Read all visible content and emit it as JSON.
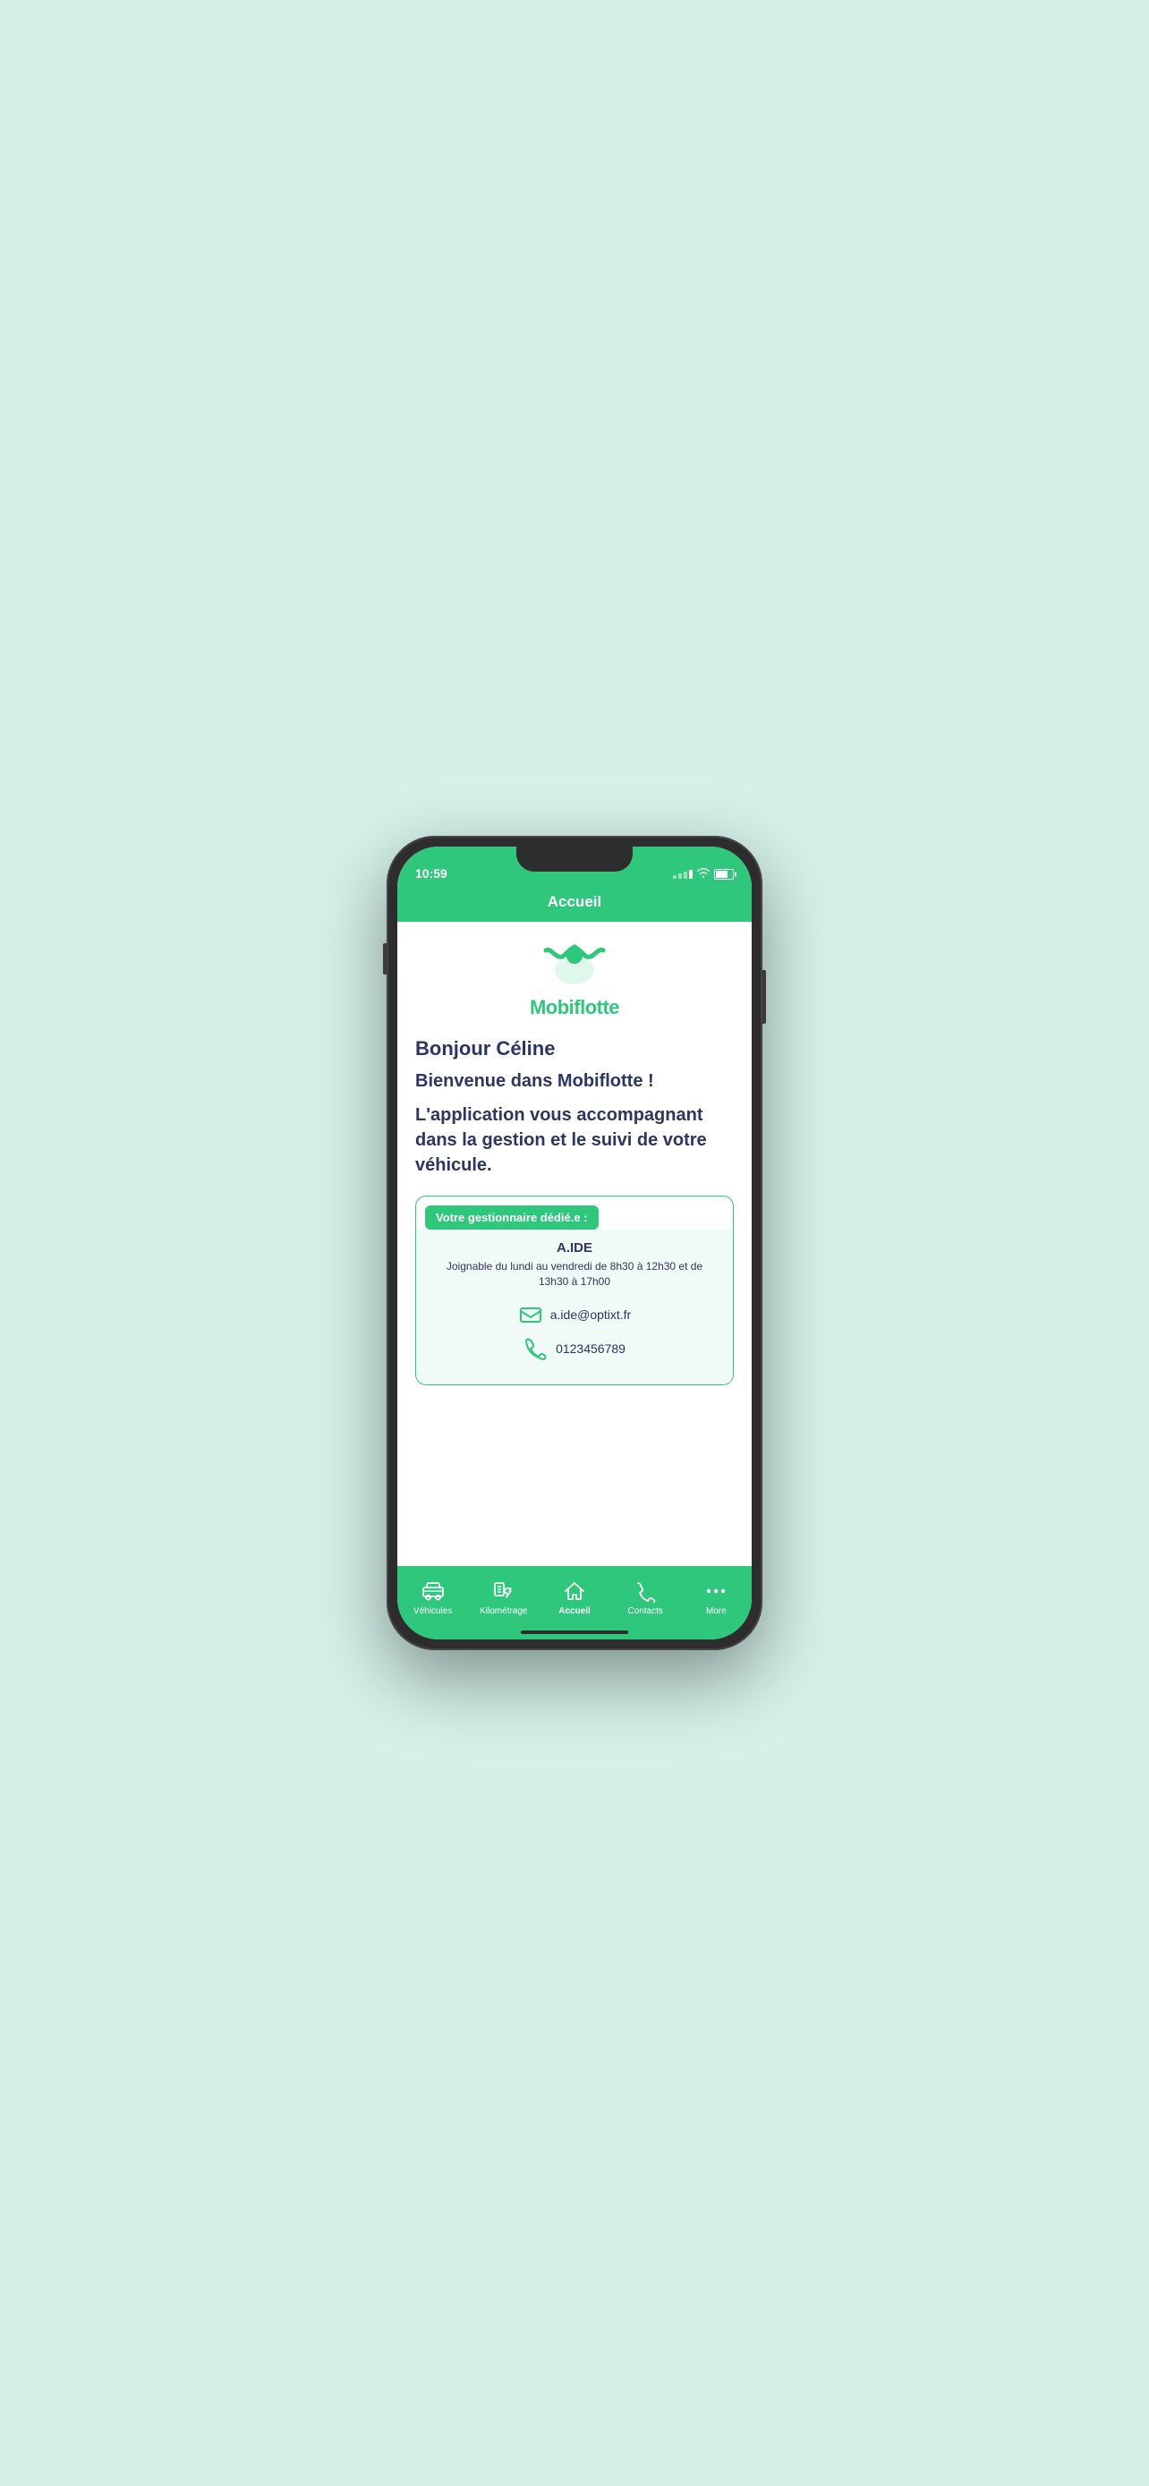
{
  "status_bar": {
    "time": "10:59"
  },
  "header": {
    "title": "Accueil"
  },
  "logo": {
    "text": "Mobiflotte"
  },
  "main": {
    "greeting": "Bonjour Céline",
    "welcome": "Bienvenue dans Mobiflotte !",
    "description": "L'application vous accompagnant dans la gestion et le suivi de votre véhicule.",
    "gestionnaire_label": "Votre gestionnaire dédié.e :",
    "gestionnaire_name": "A.IDE",
    "gestionnaire_hours": "Joignable du lundi au vendredi de 8h30 à 12h30 et de 13h30 à 17h00",
    "email": "a.ide@optixt.fr",
    "phone": "0123456789"
  },
  "tabs": [
    {
      "id": "vehicules",
      "label": "Véhicules",
      "active": false
    },
    {
      "id": "kilometrage",
      "label": "Kilométrage",
      "active": false
    },
    {
      "id": "accueil",
      "label": "Accueil",
      "active": true
    },
    {
      "id": "contacts",
      "label": "Contacts",
      "active": false
    },
    {
      "id": "more",
      "label": "More",
      "active": false
    }
  ],
  "colors": {
    "green": "#2ec77c",
    "dark_blue": "#2d3561"
  }
}
